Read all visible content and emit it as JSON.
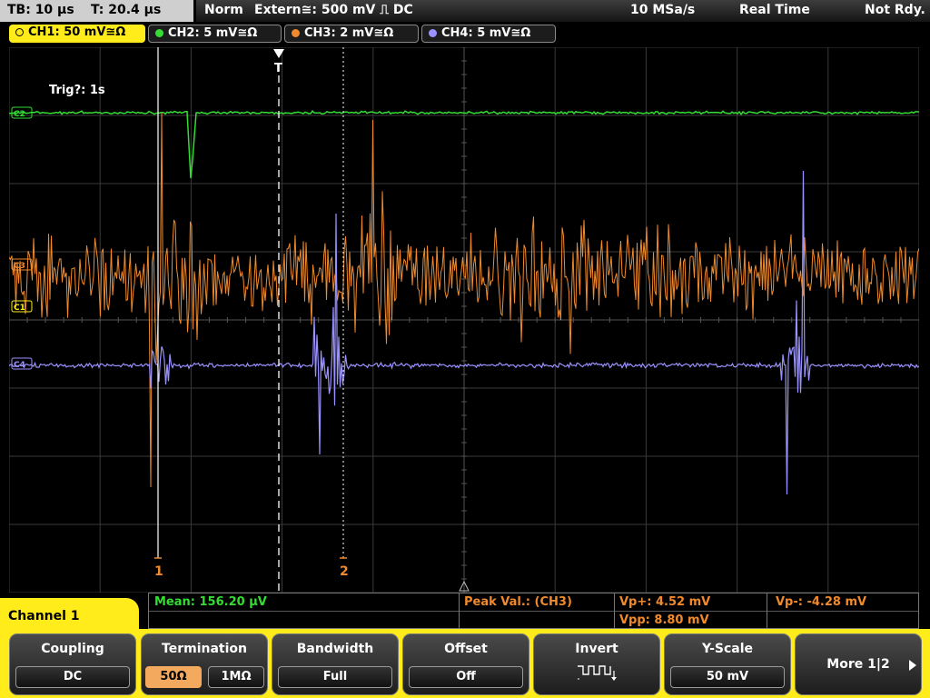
{
  "timebase": {
    "tb": "TB: 10 µs",
    "t": "T: 20.4 µs"
  },
  "status": {
    "mode": "Norm",
    "trigger": "Extern≅: 500 mV ⎍ DC",
    "sample_rate": "10 MSa/s",
    "acq": "Real Time",
    "ready": "Not Rdy."
  },
  "channels": [
    {
      "label": "CH1: 50 mV≅Ω",
      "color": "#ffec1a",
      "active": true
    },
    {
      "label": "CH2: 5 mV≅Ω",
      "color": "#33dd33",
      "active": false
    },
    {
      "label": "CH3: 2 mV≅Ω",
      "color": "#f08a2c",
      "active": false
    },
    {
      "label": "CH4: 5 mV≅Ω",
      "color": "#9a92ff",
      "active": false
    }
  ],
  "scope": {
    "trigger_info": "Trig?: 1s",
    "trigger_marker": "T",
    "ch_markers": {
      "c2": "C2",
      "c3": "C3",
      "c1": "C1",
      "c4": "C4"
    },
    "cursor1": "1",
    "cursor2": "2"
  },
  "side_tab": {
    "label": "Channel 1"
  },
  "measurements": {
    "mean": "Mean: 156.20 µV",
    "peak": "Peak Val.:  (CH3)",
    "vp_plus": "Vp+: 4.52 mV",
    "vp_minus": "Vp-: -4.28 mV",
    "vpp": "Vpp: 8.80 mV"
  },
  "softkeys": {
    "coupling": {
      "title": "Coupling",
      "value": "DC"
    },
    "termination": {
      "title": "Termination",
      "opt1": "50Ω",
      "opt2": "1MΩ"
    },
    "bandwidth": {
      "title": "Bandwidth",
      "value": "Full"
    },
    "offset": {
      "title": "Offset",
      "value": "Off"
    },
    "invert": {
      "title": "Invert"
    },
    "yscale": {
      "title": "Y-Scale",
      "value": "50 mV"
    },
    "more": {
      "title": "More 1|2"
    }
  },
  "colors": {
    "ch1": "#ffec1a",
    "ch2": "#33dd33",
    "ch3": "#f08a2c",
    "ch4": "#9a92ff",
    "mean": "#33dd33",
    "peak": "#f08a2c"
  }
}
